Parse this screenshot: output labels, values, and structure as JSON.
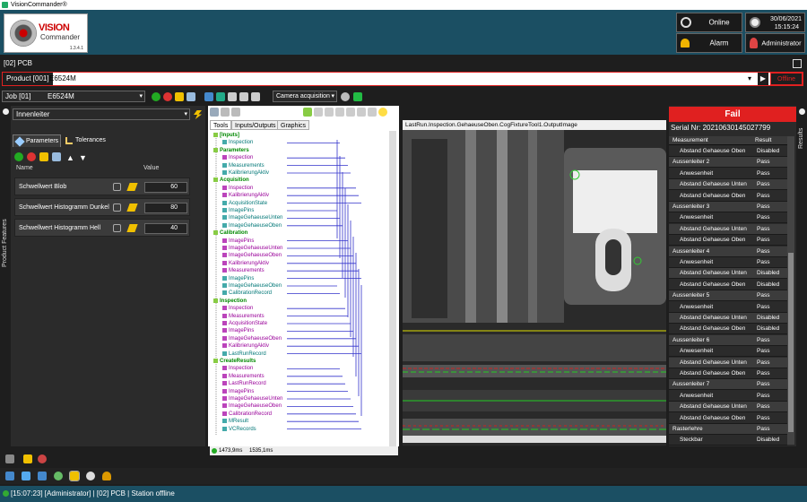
{
  "app": {
    "title": "VisionCommander®",
    "logo_line1": "VISION",
    "logo_line2": "Commander",
    "version": "1.3.4.1"
  },
  "header": {
    "online_label": "Online",
    "alarm_label": "Alarm",
    "date": "30/06/2021",
    "time": "15:15:24",
    "user_label": "Administrator"
  },
  "pcb_label": "[02] PCB",
  "product": {
    "label": "Product [001]",
    "value": "E6524M",
    "offline_label": "Offline"
  },
  "job": {
    "label": "Job [01]",
    "value": "E6524M",
    "camera_mode": "Camera acquisition"
  },
  "left_panel": {
    "vtab": "Product  Features",
    "inspection_select": "Innenleiter",
    "tabs": {
      "parameters": "Parameters",
      "tolerances": "Tolerances"
    },
    "col_name": "Name",
    "col_value": "Value",
    "params": [
      {
        "name": "Schwellwert Blob",
        "value": "60"
      },
      {
        "name": "Schwellwert Histogramm Dunkel",
        "value": "80"
      },
      {
        "name": "Schwellwert Histogramm Hell",
        "value": "40"
      }
    ]
  },
  "center": {
    "tabs": [
      "Tools",
      "Inputs/Outputs",
      "Graphics"
    ],
    "tree": [
      {
        "t": "[Inputs]",
        "k": "g",
        "d": 0
      },
      {
        "t": "Inspection",
        "k": "c",
        "d": 1
      },
      {
        "t": "Parameters",
        "k": "g",
        "d": 0
      },
      {
        "t": "Inspection",
        "k": "m",
        "d": 1
      },
      {
        "t": "Measurements",
        "k": "c",
        "d": 1
      },
      {
        "t": "KalibrierungAktiv",
        "k": "c",
        "d": 1
      },
      {
        "t": "Acquisition",
        "k": "g",
        "d": 0
      },
      {
        "t": "Inspection",
        "k": "m",
        "d": 1
      },
      {
        "t": "KalibrierungAktiv",
        "k": "m",
        "d": 1
      },
      {
        "t": "AcquisitionState",
        "k": "c",
        "d": 1
      },
      {
        "t": "ImagePins",
        "k": "c",
        "d": 1
      },
      {
        "t": "ImageGehaeuseUnten",
        "k": "c",
        "d": 1
      },
      {
        "t": "ImageGehaeuseOben",
        "k": "c",
        "d": 1
      },
      {
        "t": "Calibration",
        "k": "g",
        "d": 0
      },
      {
        "t": "ImagePins",
        "k": "m",
        "d": 1
      },
      {
        "t": "ImageGehaeuseUnten",
        "k": "m",
        "d": 1
      },
      {
        "t": "ImageGehaeuseOben",
        "k": "m",
        "d": 1
      },
      {
        "t": "KalibrierungAktiv",
        "k": "m",
        "d": 1
      },
      {
        "t": "Measurements",
        "k": "m",
        "d": 1
      },
      {
        "t": "ImagePins",
        "k": "c",
        "d": 1
      },
      {
        "t": "ImageGehaeuseOben",
        "k": "c",
        "d": 1
      },
      {
        "t": "CalibrationRecord",
        "k": "c",
        "d": 1
      },
      {
        "t": "Inspection",
        "k": "g",
        "d": 0
      },
      {
        "t": "Inspection",
        "k": "m",
        "d": 1
      },
      {
        "t": "Measurements",
        "k": "m",
        "d": 1
      },
      {
        "t": "AcquisitionState",
        "k": "m",
        "d": 1
      },
      {
        "t": "ImagePins",
        "k": "m",
        "d": 1
      },
      {
        "t": "ImageGehaeuseOben",
        "k": "m",
        "d": 1
      },
      {
        "t": "KalibrierungAktiv",
        "k": "m",
        "d": 1
      },
      {
        "t": "LastRunRecord",
        "k": "c",
        "d": 1
      },
      {
        "t": "CreateResults",
        "k": "g",
        "d": 0
      },
      {
        "t": "Inspection",
        "k": "m",
        "d": 1
      },
      {
        "t": "Measurements",
        "k": "m",
        "d": 1
      },
      {
        "t": "LastRunRecord",
        "k": "m",
        "d": 1
      },
      {
        "t": "ImagePins",
        "k": "m",
        "d": 1
      },
      {
        "t": "ImageGehaeuseUnten",
        "k": "m",
        "d": 1
      },
      {
        "t": "ImageGehaeuseOben",
        "k": "m",
        "d": 1
      },
      {
        "t": "CalibrationRecord",
        "k": "m",
        "d": 1
      },
      {
        "t": "MResult",
        "k": "c",
        "d": 1
      },
      {
        "t": "VCRecords",
        "k": "c",
        "d": 1
      }
    ],
    "status_time": "1473,9ms",
    "status_time2": "1535,1ms"
  },
  "image": {
    "title": "LastRun.Inspection.GehaeuseOben.CogFixtureTool1.OutputImage"
  },
  "results": {
    "status": "Fail",
    "serial": "Serial Nr: 20210630145027799",
    "col_measurement": "Measurement",
    "col_result": "Result",
    "vtab": "Results",
    "rows": [
      {
        "m": "Abstand Gehaeuse Oben",
        "r": "Disabled",
        "type": "sub"
      },
      {
        "m": "Aussenleiter 2",
        "r": "Pass",
        "type": "grp"
      },
      {
        "m": "Anwesenheit",
        "r": "Pass",
        "type": "sub"
      },
      {
        "m": "Abstand Gehaeuse Unten",
        "r": "Pass",
        "type": "sub"
      },
      {
        "m": "Abstand Gehaeuse Oben",
        "r": "Pass",
        "type": "sub"
      },
      {
        "m": "Aussenleiter 3",
        "r": "Pass",
        "type": "grp"
      },
      {
        "m": "Anwesenheit",
        "r": "Pass",
        "type": "sub"
      },
      {
        "m": "Abstand Gehaeuse Unten",
        "r": "Pass",
        "type": "sub"
      },
      {
        "m": "Abstand Gehaeuse Oben",
        "r": "Pass",
        "type": "sub"
      },
      {
        "m": "Aussenleiter 4",
        "r": "Pass",
        "type": "grp"
      },
      {
        "m": "Anwesenheit",
        "r": "Pass",
        "type": "sub"
      },
      {
        "m": "Abstand Gehaeuse Unten",
        "r": "Disabled",
        "type": "sub"
      },
      {
        "m": "Abstand Gehaeuse Oben",
        "r": "Disabled",
        "type": "sub"
      },
      {
        "m": "Aussenleiter 5",
        "r": "Pass",
        "type": "grp"
      },
      {
        "m": "Anwesenheit",
        "r": "Pass",
        "type": "sub"
      },
      {
        "m": "Abstand Gehaeuse Unten",
        "r": "Disabled",
        "type": "sub"
      },
      {
        "m": "Abstand Gehaeuse Oben",
        "r": "Disabled",
        "type": "sub"
      },
      {
        "m": "Aussenleiter 6",
        "r": "Pass",
        "type": "grp"
      },
      {
        "m": "Anwesenheit",
        "r": "Pass",
        "type": "sub"
      },
      {
        "m": "Abstand Gehaeuse Unten",
        "r": "Pass",
        "type": "sub"
      },
      {
        "m": "Abstand Gehaeuse Oben",
        "r": "Pass",
        "type": "sub"
      },
      {
        "m": "Aussenleiter 7",
        "r": "Pass",
        "type": "grp"
      },
      {
        "m": "Anwesenheit",
        "r": "Pass",
        "type": "sub"
      },
      {
        "m": "Abstand Gehaeuse Unten",
        "r": "Pass",
        "type": "sub"
      },
      {
        "m": "Abstand Gehaeuse Oben",
        "r": "Pass",
        "type": "sub"
      },
      {
        "m": "Rasterlehre",
        "r": "Pass",
        "type": "grp"
      },
      {
        "m": "Steckbar",
        "r": "Disabled",
        "type": "sub"
      }
    ]
  },
  "statusbar": {
    "text": "[15:07:23] [Administrator] | [02] PCB | Station offline"
  },
  "colors": {
    "header": "#1b4f63",
    "fail": "#e02020",
    "pass_bg": "#2b2b2b"
  }
}
